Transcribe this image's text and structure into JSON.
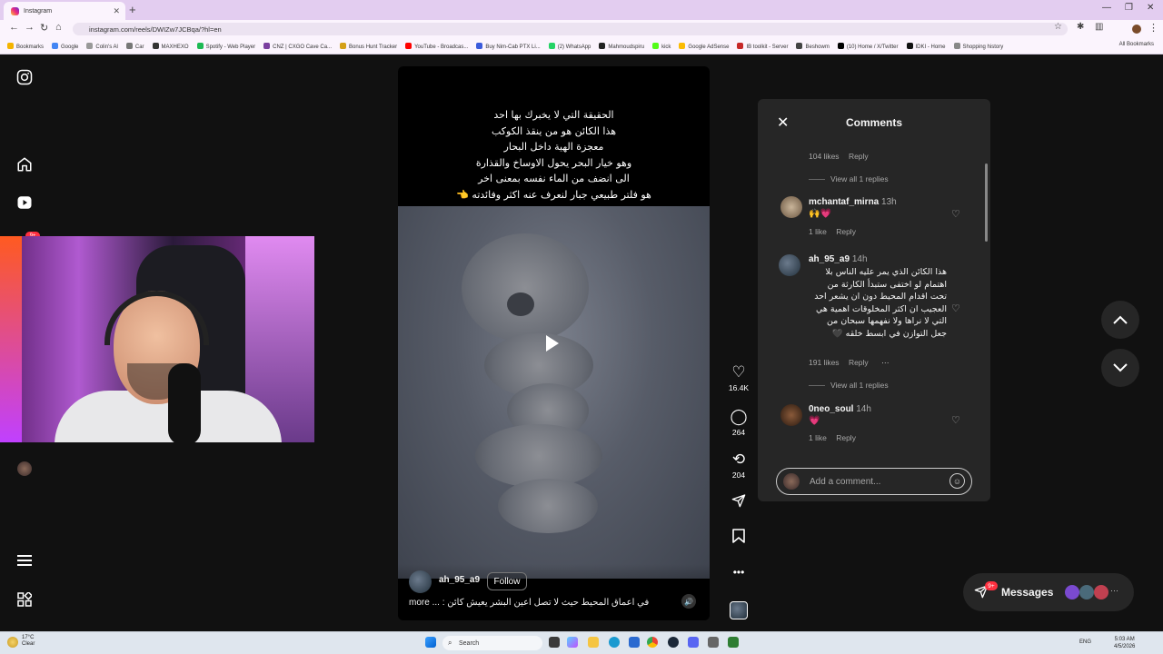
{
  "browser": {
    "tab_title": "Instagram",
    "url": "instagram.com/reels/DWIZw7JCBqa/?hl=en",
    "bookmarks": [
      "Bookmarks",
      "Google",
      "Colin's Al",
      "Car",
      "MAXHEXO",
      "Spotify - Web Player",
      "CNZ | CXGO Cave Ca...",
      "Bonus Hunt Tracker",
      "YouTube - Broadcas...",
      "Buy Nim-Cab PTX Li...",
      "(2) WhatsApp",
      "Mahmoudspiru",
      "kick",
      "Google AdSense",
      "IB toolkit - Server",
      "Beshowm",
      "(10) Home / X/Twitter",
      "IDKI - Home",
      "Shopping history"
    ],
    "all_bookmarks": "All Bookmarks",
    "bookmark_colors": [
      "#f4b400",
      "#4285f4",
      "#999",
      "#777",
      "#333",
      "#1db954",
      "#7b3fa0",
      "#d4a017",
      "#ff0000",
      "#3b5bdb",
      "#25d366",
      "#222",
      "#53fc18",
      "#fbbc04",
      "#c62828",
      "#444",
      "#000",
      "#111",
      "#888"
    ]
  },
  "sidebar": {
    "notification_badge": "9+"
  },
  "reel": {
    "overlay_lines": [
      "الحقيقة التي لا يخبرك بها احد",
      "هذا الكائن هو من ينقذ الكوكب",
      "معجزة الهية داخل البحار",
      "وهو خيار البحر يحول الاوساخ والقذارة",
      "الى انضف من الماء نفسه بمعنى اخر",
      "هو فلتر طبيعي جبار لنعرف عنه اكثر وفائدته 👈"
    ],
    "author": "ah_95_a9",
    "follow_label": "Follow",
    "caption": "في اعماق المحيط حيث لا تصل اعين البشر يعيش كائن : ...",
    "more_label": "more",
    "mute_icon": "🔊"
  },
  "actions": {
    "likes": "16.4K",
    "comments": "264",
    "reposts": "204"
  },
  "comments": {
    "title": "Comments",
    "top_meta": {
      "likes": "104 likes",
      "reply": "Reply"
    },
    "top_view_replies": "View all 1 replies",
    "items": [
      {
        "user": "mchantaf_mirna",
        "time": "13h",
        "text": "🙌💗",
        "likes": "1 like",
        "reply": "Reply"
      },
      {
        "user": "ah_95_a9",
        "time": "14h",
        "text": "هذا الكائن الذي يمر عليه الناس بلا اهتمام لو اختفى ستبدأ الكارثة من تحت اقدام المحيط دون ان يشعر احد العجيب ان اكثر المخلوقات اهمية هي التي لا نراها ولا نفهمها سبحان من جعل التوازن في ابسط خلقه 🖤",
        "likes": "191 likes",
        "reply": "Reply",
        "more": "···",
        "view_replies": "View all 1 replies"
      },
      {
        "user": "0neo_soul",
        "time": "14h",
        "text": "💗",
        "likes": "1 like",
        "reply": "Reply"
      }
    ],
    "add_placeholder": "Add a comment..."
  },
  "messages": {
    "label": "Messages",
    "badge": "9+"
  },
  "taskbar": {
    "temperature": "17°C",
    "weather": "Clear",
    "search": "Search",
    "lang": "ENG",
    "time": "5:03 AM",
    "date": "4/5/2026"
  }
}
